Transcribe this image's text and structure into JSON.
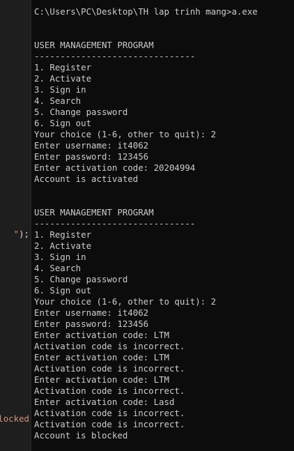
{
  "editor": {
    "fragment_1_quote": "\"",
    "fragment_1_rest": ");",
    "fragment_2": "locked"
  },
  "terminal": {
    "lines": [
      "C:\\Users\\PC\\Desktop\\TH lap trinh mang>a.exe",
      "",
      "",
      "USER MANAGEMENT PROGRAM",
      "-------------------------------",
      "1. Register",
      "2. Activate",
      "3. Sign in",
      "4. Search",
      "5. Change password",
      "6. Sign out",
      "Your choice (1-6, other to quit): 2",
      "Enter username: it4062",
      "Enter password: 123456",
      "Enter activation code: 20204994",
      "Account is activated",
      "",
      "",
      "USER MANAGEMENT PROGRAM",
      "-------------------------------",
      "1. Register",
      "2. Activate",
      "3. Sign in",
      "4. Search",
      "5. Change password",
      "6. Sign out",
      "Your choice (1-6, other to quit): 2",
      "Enter username: it4062",
      "Enter password: 123456",
      "Enter activation code: LTM",
      "Activation code is incorrect.",
      "Enter activation code: LTM",
      "Activation code is incorrect.",
      "Enter activation code: LTM",
      "Activation code is incorrect.",
      "Enter activation code: Lasd",
      "Activation code is incorrect.",
      "Activation code is incorrect.",
      "Account is blocked"
    ]
  }
}
